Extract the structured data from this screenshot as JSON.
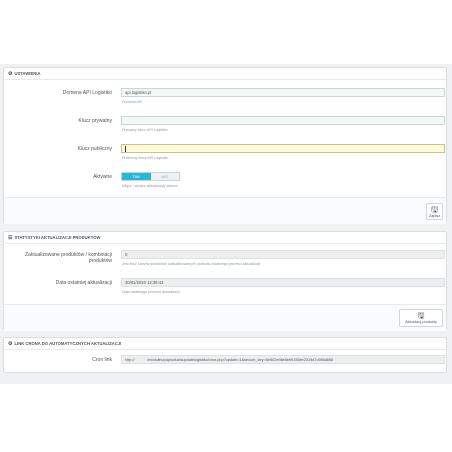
{
  "settings": {
    "header": "USTAWIENIA",
    "domain_label": "Domena API Logistiko",
    "domain_value": "api.logistiko.pl",
    "domain_help": "Domena API",
    "private_key_label": "Klucz prywatny",
    "private_key_value": "",
    "private_key_help": "Prywatny klucz API Logistiko",
    "public_key_label": "Klucz publiczny",
    "public_key_value": "",
    "public_key_help": "Publiczny klucz API Logistiko",
    "active_label": "Aktywne",
    "toggle_on": "TAK",
    "toggle_off": "NIE",
    "active_help": "Włącz / wyłącz aktualizację stanów",
    "save_label": "Zapisz"
  },
  "stats": {
    "header": "STATYSTYKI AKTUALIZACJI PRODUKTÓW",
    "loaded_label_1": "Zaktualizowane produktów / kombinacji",
    "loaded_label_2": "produktów",
    "loaded_value": "0",
    "loaded_help": "Jest ilość stanów produktów zaktualizowanych podczas ostatniego procesu aktualizacji",
    "date_label": "Data ostatniej aktualizacji",
    "date_value": "30/01/2020 12:36:42",
    "date_help": "Data ostatniego procesu aktualizacji",
    "update_button": "Aktualizuj produkty"
  },
  "cron": {
    "header": "LINK CRONA DO AUTOMATYCZNYCH AKTUALIZACJI",
    "label": "Cron link",
    "value": "http://            /modules/pdproductsupdatelogistiko/cron.php?update=1&secure_key=5e502e98e8eb9155ee2319a7c988d668"
  }
}
